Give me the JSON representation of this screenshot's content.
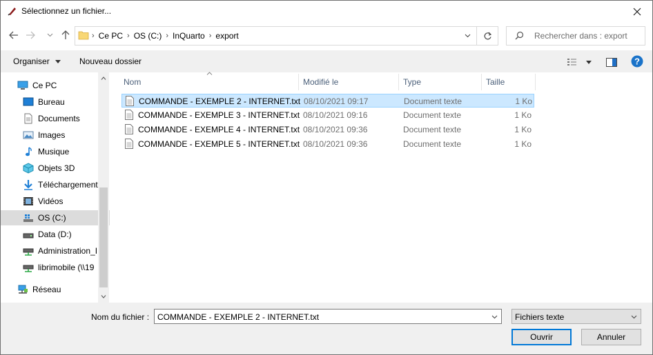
{
  "window": {
    "title": "Sélectionnez un fichier..."
  },
  "address": {
    "crumbs": [
      "Ce PC",
      "OS (C:)",
      "InQuarto",
      "export"
    ]
  },
  "search": {
    "placeholder": "Rechercher dans : export"
  },
  "toolbar": {
    "organize_label": "Organiser",
    "new_folder_label": "Nouveau dossier"
  },
  "sidebar": {
    "items": [
      {
        "label": "Ce PC",
        "icon": "computer-icon"
      },
      {
        "label": "Bureau",
        "icon": "desktop-icon"
      },
      {
        "label": "Documents",
        "icon": "documents-icon"
      },
      {
        "label": "Images",
        "icon": "pictures-icon"
      },
      {
        "label": "Musique",
        "icon": "music-icon"
      },
      {
        "label": "Objets 3D",
        "icon": "3d-objects-icon"
      },
      {
        "label": "Téléchargements",
        "icon": "downloads-icon"
      },
      {
        "label": "Vidéos",
        "icon": "videos-icon"
      },
      {
        "label": "OS (C:)",
        "icon": "windows-drive-icon"
      },
      {
        "label": "Data (D:)",
        "icon": "drive-icon"
      },
      {
        "label": "Administration_I",
        "icon": "network-drive-icon"
      },
      {
        "label": "librimobile (\\\\19",
        "icon": "network-drive-icon"
      },
      {
        "label": "Réseau",
        "icon": "network-icon"
      }
    ]
  },
  "columns": {
    "name": "Nom",
    "modified": "Modifié le",
    "type": "Type",
    "size": "Taille"
  },
  "files": [
    {
      "name": "COMMANDE - EXEMPLE 2 - INTERNET.txt",
      "modified": "08/10/2021 09:17",
      "type": "Document texte",
      "size": "1 Ko"
    },
    {
      "name": "COMMANDE - EXEMPLE 3 - INTERNET.txt",
      "modified": "08/10/2021 09:16",
      "type": "Document texte",
      "size": "1 Ko"
    },
    {
      "name": "COMMANDE - EXEMPLE 4 - INTERNET.txt",
      "modified": "08/10/2021 09:36",
      "type": "Document texte",
      "size": "1 Ko"
    },
    {
      "name": "COMMANDE - EXEMPLE 5 - INTERNET.txt",
      "modified": "08/10/2021 09:36",
      "type": "Document texte",
      "size": "1 Ko"
    }
  ],
  "footer": {
    "filename_label": "Nom du fichier :",
    "filename_value": "COMMANDE - EXEMPLE 2 - INTERNET.txt",
    "filter_value": "Fichiers texte",
    "open_label": "Ouvrir",
    "cancel_label": "Annuler"
  },
  "colors": {
    "accent": "#0078d7",
    "selection": "#cce8ff",
    "help": "#1a73c9"
  }
}
